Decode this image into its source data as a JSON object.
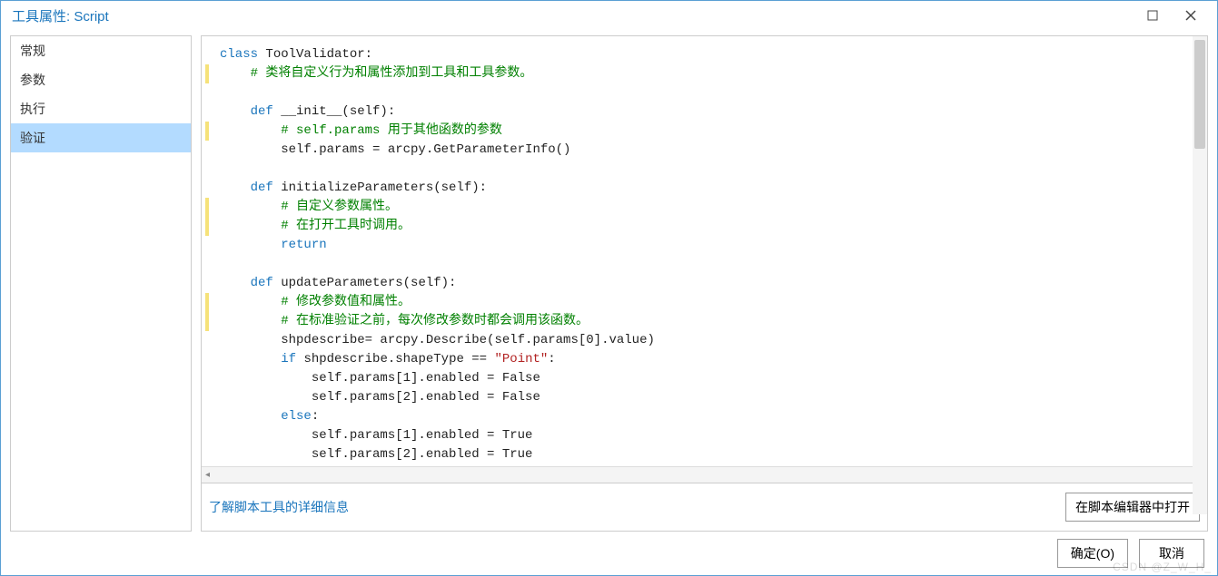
{
  "window": {
    "title": "工具属性: Script"
  },
  "sidebar": {
    "items": [
      {
        "label": "常规"
      },
      {
        "label": "参数"
      },
      {
        "label": "执行"
      },
      {
        "label": "验证"
      }
    ],
    "selected_index": 3
  },
  "code": {
    "lines": [
      {
        "seg": [
          [
            "k",
            "class "
          ],
          [
            "n",
            "ToolValidator:"
          ]
        ]
      },
      {
        "hl": true,
        "seg": [
          [
            "n",
            "    "
          ],
          [
            "c",
            "# 类将自定义行为和属性添加到工具和工具参数。"
          ]
        ]
      },
      {
        "seg": [
          [
            "n",
            ""
          ]
        ]
      },
      {
        "seg": [
          [
            "n",
            "    "
          ],
          [
            "k",
            "def "
          ],
          [
            "n",
            "__init__(self):"
          ]
        ]
      },
      {
        "hl": true,
        "seg": [
          [
            "n",
            "        "
          ],
          [
            "c",
            "# self.params 用于其他函数的参数"
          ]
        ]
      },
      {
        "seg": [
          [
            "n",
            "        self.params = arcpy.GetParameterInfo()"
          ]
        ]
      },
      {
        "seg": [
          [
            "n",
            ""
          ]
        ]
      },
      {
        "seg": [
          [
            "n",
            "    "
          ],
          [
            "k",
            "def "
          ],
          [
            "n",
            "initializeParameters(self):"
          ]
        ]
      },
      {
        "hl": true,
        "seg": [
          [
            "n",
            "        "
          ],
          [
            "c",
            "# 自定义参数属性。"
          ]
        ]
      },
      {
        "hl": true,
        "seg": [
          [
            "n",
            "        "
          ],
          [
            "c",
            "# 在打开工具时调用。"
          ]
        ]
      },
      {
        "seg": [
          [
            "n",
            "        "
          ],
          [
            "k",
            "return"
          ]
        ]
      },
      {
        "seg": [
          [
            "n",
            ""
          ]
        ]
      },
      {
        "seg": [
          [
            "n",
            "    "
          ],
          [
            "k",
            "def "
          ],
          [
            "n",
            "updateParameters(self):"
          ]
        ]
      },
      {
        "hl": true,
        "seg": [
          [
            "n",
            "        "
          ],
          [
            "c",
            "# 修改参数值和属性。"
          ]
        ]
      },
      {
        "hl": true,
        "seg": [
          [
            "n",
            "        "
          ],
          [
            "c",
            "# 在标准验证之前，每次修改参数时都会调用该函数。"
          ]
        ]
      },
      {
        "seg": [
          [
            "n",
            "        shpdescribe= arcpy.Describe(self.params[0].value)"
          ]
        ]
      },
      {
        "seg": [
          [
            "n",
            "        "
          ],
          [
            "k",
            "if "
          ],
          [
            "n",
            "shpdescribe.shapeType == "
          ],
          [
            "s",
            "\"Point\""
          ],
          [
            "n",
            ":"
          ]
        ]
      },
      {
        "seg": [
          [
            "n",
            "            self.params[1].enabled = False"
          ]
        ]
      },
      {
        "seg": [
          [
            "n",
            "            self.params[2].enabled = False"
          ]
        ]
      },
      {
        "seg": [
          [
            "n",
            "        "
          ],
          [
            "k",
            "else"
          ],
          [
            "n",
            ":"
          ]
        ]
      },
      {
        "seg": [
          [
            "n",
            "            self.params[1].enabled = True"
          ]
        ]
      },
      {
        "seg": [
          [
            "n",
            "            self.params[2].enabled = True"
          ]
        ]
      }
    ]
  },
  "links": {
    "learn_more": "了解脚本工具的详细信息",
    "open_in_editor": "在脚本编辑器中打开"
  },
  "footer": {
    "ok": "确定(O)",
    "cancel": "取消"
  },
  "watermark": "CSDN @Z_W_H_"
}
